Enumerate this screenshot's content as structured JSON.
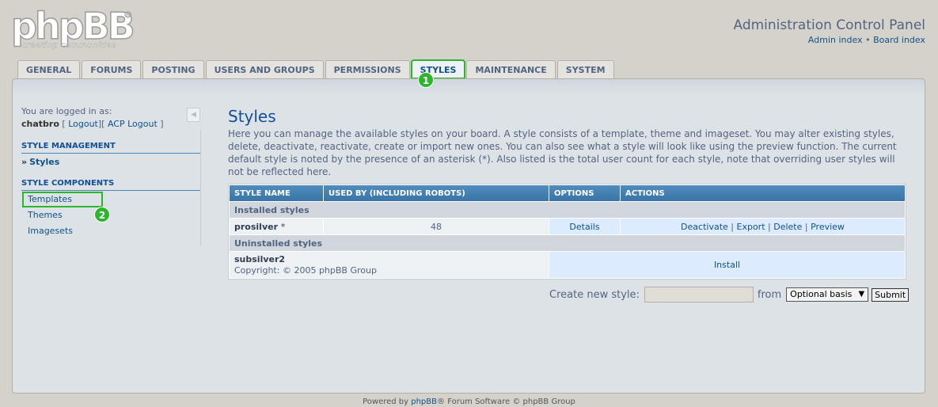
{
  "header": {
    "logo_main": "phpBB",
    "logo_reg": "®",
    "logo_sub": "creating communities",
    "acp_title": "Administration Control Panel",
    "admin_index": "Admin index",
    "separator": "•",
    "board_index": "Board index"
  },
  "tabs": [
    {
      "label": "GENERAL"
    },
    {
      "label": "FORUMS"
    },
    {
      "label": "POSTING"
    },
    {
      "label": "USERS AND GROUPS"
    },
    {
      "label": "PERMISSIONS"
    },
    {
      "label": "STYLES",
      "active": true
    },
    {
      "label": "MAINTENANCE"
    },
    {
      "label": "SYSTEM"
    }
  ],
  "badges": {
    "one": "1",
    "two": "2"
  },
  "sidebar": {
    "logged_in_as": "You are logged in as:",
    "username": "chatbro",
    "logout": "Logout",
    "acp_logout": "ACP Logout",
    "bracket_open": "[",
    "bracket_mid": "][",
    "bracket_close": "]",
    "collapse_icon": "◀",
    "style_management": "STYLE MANAGEMENT",
    "styles_item": "Styles",
    "active_arrow": "»",
    "style_components": "STYLE COMPONENTS",
    "templates": "Templates",
    "themes": "Themes",
    "imagesets": "Imagesets"
  },
  "content": {
    "title": "Styles",
    "intro": "Here you can manage the available styles on your board. A style consists of a template, theme and imageset. You may alter existing styles, delete, deactivate, reactivate, create or import new ones. You can also see what a style will look like using the preview function. The current default style is noted by the presence of an asterisk (*). Also listed is the total user count for each style, note that overriding user styles will not be reflected here."
  },
  "table": {
    "headers": [
      "STYLE NAME",
      "USED BY (INCLUDING ROBOTS)",
      "OPTIONS",
      "ACTIONS"
    ],
    "installed_label": "Installed styles",
    "installed_name": "prosilver",
    "installed_default_mark": "*",
    "installed_count": "48",
    "details": "Details",
    "actions": [
      "Deactivate",
      "Export",
      "Delete",
      "Preview"
    ],
    "action_sep": "|",
    "uninstalled_label": "Uninstalled styles",
    "uninstalled_name": "subsilver2",
    "uninstalled_copyright": "Copyright: © 2005 phpBB Group",
    "install": "Install"
  },
  "create": {
    "label": "Create new style:",
    "input_value": "",
    "from": "from",
    "select_value": "Optional basis",
    "caret": "▼",
    "submit": "Submit"
  },
  "footer": {
    "powered_by": "Powered by",
    "phpbb_link": "phpBB",
    "rest": "® Forum Software © phpBB Group"
  }
}
